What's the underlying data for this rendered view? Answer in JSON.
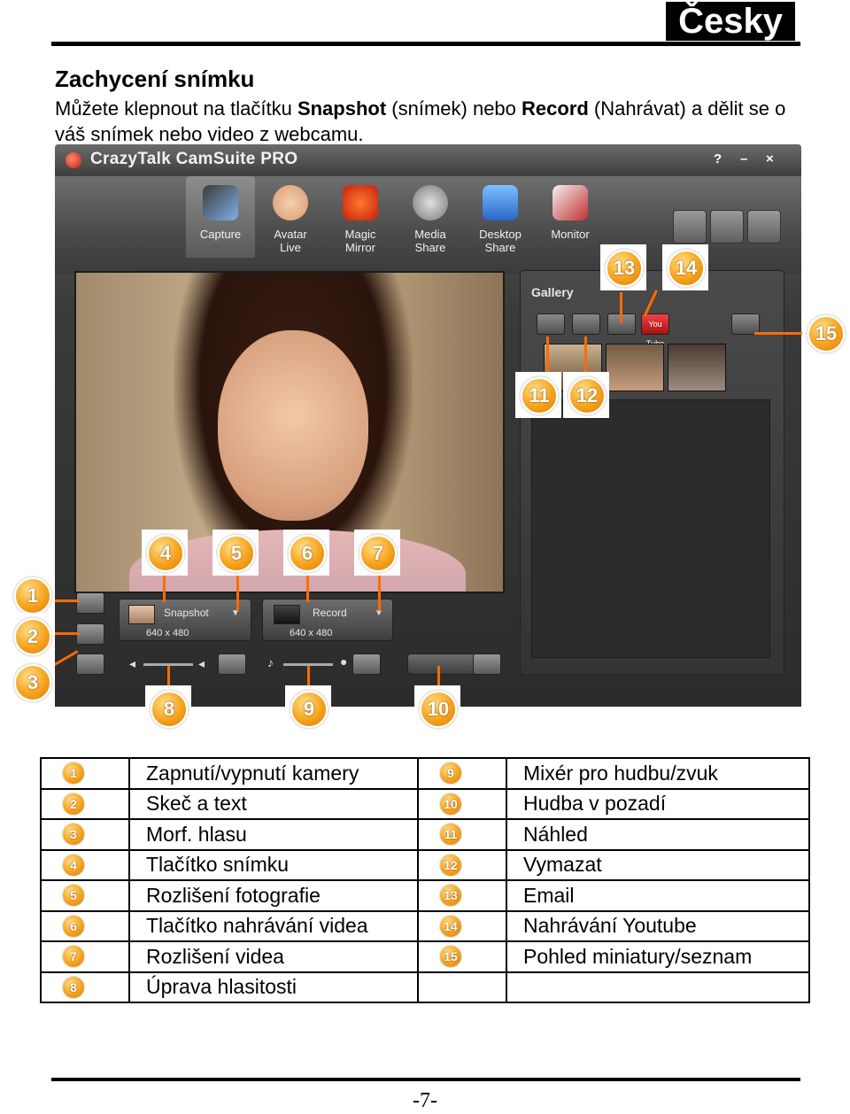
{
  "header": {
    "language": "Česky"
  },
  "section": {
    "title": "Zachycení snímku",
    "intro_a": "Můžete klepnout na tlačítku ",
    "intro_b": "Snapshot",
    "intro_c": " (snímek) nebo ",
    "intro_d": "Record",
    "intro_e": " (Nahrávat) a dělit se o váš snímek nebo video z webcamu."
  },
  "app": {
    "title": "CrazyTalk CamSuite PRO",
    "window_controls": [
      "?",
      "–",
      "×"
    ],
    "modes": [
      "Capture",
      "Avatar\nLive",
      "Magic\nMirror",
      "Media\nShare",
      "Desktop\nShare",
      "Monitor"
    ],
    "gallery_title": "Gallery",
    "snapshot": {
      "label": "Snapshot",
      "resolution": "640 x 480"
    },
    "record": {
      "label": "Record",
      "resolution": "640 x 480"
    },
    "youtube_label": "You Tube"
  },
  "callouts": [
    "1",
    "2",
    "3",
    "4",
    "5",
    "6",
    "7",
    "8",
    "9",
    "10",
    "11",
    "12",
    "13",
    "14",
    "15"
  ],
  "legend": [
    {
      "n1": "1",
      "t1": "Zapnutí/vypnutí kamery",
      "n2": "9",
      "t2": "Mixér pro hudbu/zvuk"
    },
    {
      "n1": "2",
      "t1": "Skeč a text",
      "n2": "10",
      "t2": "Hudba v pozadí"
    },
    {
      "n1": "3",
      "t1": "Morf. hlasu",
      "n2": "11",
      "t2": "Náhled"
    },
    {
      "n1": "4",
      "t1": "Tlačítko snímku",
      "n2": "12",
      "t2": "Vymazat"
    },
    {
      "n1": "5",
      "t1": "Rozlišení fotografie",
      "n2": "13",
      "t2": "Email"
    },
    {
      "n1": "6",
      "t1": "Tlačítko nahrávání videa",
      "n2": "14",
      "t2": "Nahrávání Youtube"
    },
    {
      "n1": "7",
      "t1": "Rozlišení videa",
      "n2": "15",
      "t2": "Pohled miniatury/seznam"
    },
    {
      "n1": "8",
      "t1": "Úprava hlasitosti",
      "n2": "",
      "t2": ""
    }
  ],
  "footer": {
    "page": "-7-"
  }
}
